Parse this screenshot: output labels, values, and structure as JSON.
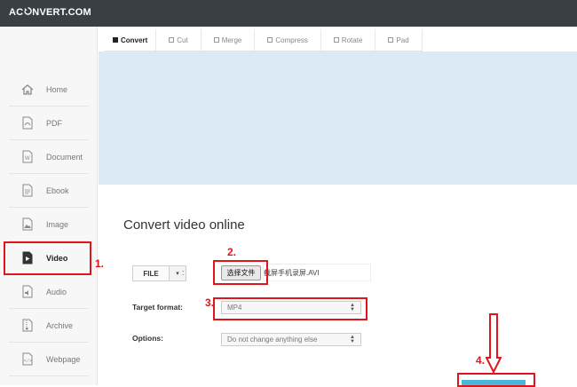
{
  "header": {
    "logo_left": "AC",
    "logo_right": "NVERT.COM"
  },
  "sidebar": {
    "items": [
      {
        "label": "Home",
        "icon": "home-icon"
      },
      {
        "label": "PDF",
        "icon": "pdf-icon"
      },
      {
        "label": "Document",
        "icon": "document-icon"
      },
      {
        "label": "Ebook",
        "icon": "ebook-icon"
      },
      {
        "label": "Image",
        "icon": "image-icon"
      },
      {
        "label": "Video",
        "icon": "video-icon",
        "active": true
      },
      {
        "label": "Audio",
        "icon": "audio-icon"
      },
      {
        "label": "Archive",
        "icon": "archive-icon"
      },
      {
        "label": "Webpage",
        "icon": "webpage-icon"
      }
    ]
  },
  "tabs": [
    {
      "label": "Convert",
      "active": true
    },
    {
      "label": "Cut"
    },
    {
      "label": "Merge"
    },
    {
      "label": "Compress"
    },
    {
      "label": "Rotate"
    },
    {
      "label": "Pad"
    }
  ],
  "main": {
    "title": "Convert video online",
    "file_button": "FILE",
    "file_dropdown": "▾",
    "colon": ":",
    "choose_file": "选择文件",
    "file_name": "截屏手机录屏.AVI",
    "target_format_label": "Target format:",
    "target_format_value": "MP4",
    "options_label": "Options:",
    "options_value": "Do not change anything else"
  },
  "annotations": {
    "step1": "1.",
    "step2": "2.",
    "step3": "3.",
    "step4": "4."
  },
  "colors": {
    "topbar": "#3a3f43",
    "ad_area": "#dbeaf4",
    "annotation": "#e0151b",
    "convert_button": "#47b8d8"
  }
}
